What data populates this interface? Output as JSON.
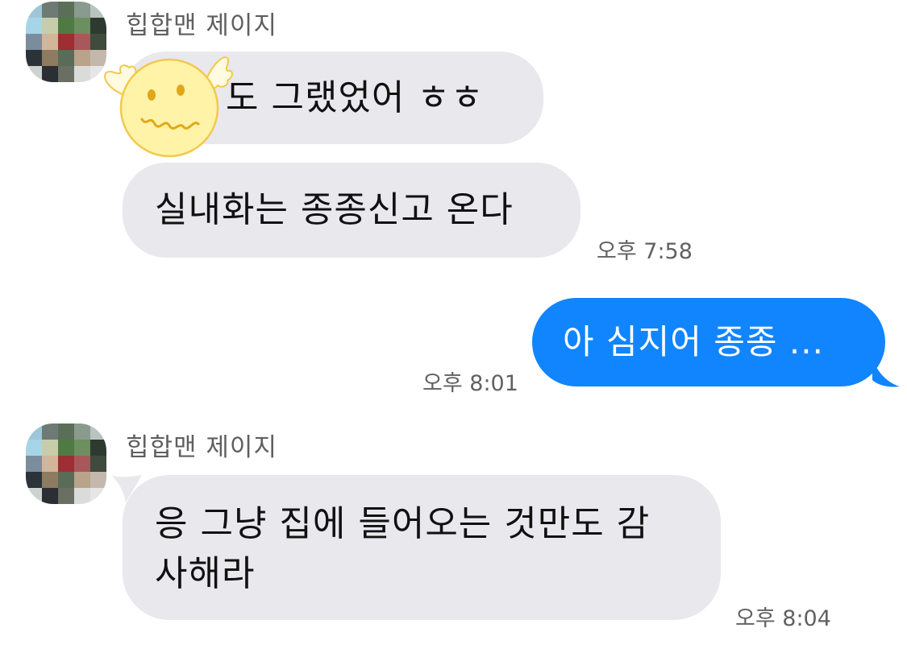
{
  "chat": {
    "groups": [
      {
        "sender": "힙합맨 제이지",
        "messages": [
          {
            "text": "도 그랬었어 ㅎㅎ"
          },
          {
            "text": "실내화는 종종신고 온다",
            "time": "오후 7:58"
          }
        ]
      },
      {
        "sender": "me",
        "messages": [
          {
            "text": "아 심지어 종종 ...",
            "time": "오후 8:01"
          }
        ]
      },
      {
        "sender": "힙합맨 제이지",
        "messages": [
          {
            "line1": "응 그냥 집에 들어오는 것만도 감",
            "line2": "사해라",
            "time": "오후 8:04"
          }
        ]
      }
    ]
  },
  "theme": {
    "incoming_bubble": "#e8e8ed",
    "outgoing_bubble": "#1185fd",
    "sticker_fill": "#fff3a8",
    "sticker_stroke": "#f2c94c"
  },
  "icons": {
    "sticker": "winged-smiley-sticker",
    "avatar": "pixelated-profile-photo"
  }
}
